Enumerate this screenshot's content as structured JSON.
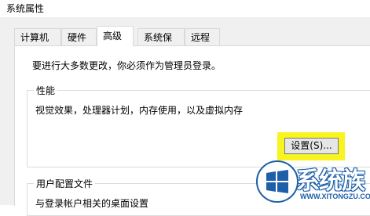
{
  "window": {
    "title": "系统属性"
  },
  "tabs": [
    {
      "label": "计算机名"
    },
    {
      "label": "硬件"
    },
    {
      "label": "高级"
    },
    {
      "label": "系统保护"
    },
    {
      "label": "远程"
    }
  ],
  "advanced": {
    "admin_note": "要进行大多数更改，你必须作为管理员登录。",
    "performance": {
      "title": "性能",
      "description": "视觉效果，处理器计划，内存使用，以及虚拟内存",
      "settings_button": "设置(S)..."
    },
    "user_profiles": {
      "title": "用户配置文件",
      "description": "与登录帐户相关的桌面设置"
    }
  },
  "watermark": {
    "text": "系统族",
    "url": "WWW.XITONGZU.COM"
  },
  "colors": {
    "highlight": "#f7f41f",
    "watermark_blue": "#1d5fa8"
  }
}
